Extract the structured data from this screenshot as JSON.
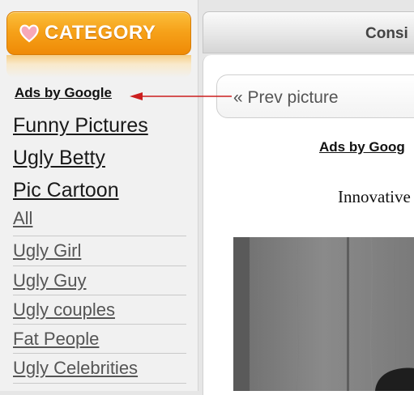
{
  "sidebar": {
    "header_title": "CATEGORY",
    "header_icon": "heart-icon",
    "ads_label": "Ads by Google",
    "featured_links": [
      "Funny Pictures",
      "Ugly Betty",
      "Pic Cartoon"
    ],
    "categories": [
      "All",
      "Ugly Girl",
      "Ugly Guy",
      "Ugly couples",
      "Fat People",
      "Ugly Celebrities"
    ]
  },
  "main": {
    "tab_label": "Consi",
    "prev_label": "« Prev picture",
    "ads_label": "Ads by Goog",
    "caption": "Innovative"
  },
  "colors": {
    "header_orange": "#f6a21a",
    "annotation_arrow": "#cc1f1f"
  }
}
